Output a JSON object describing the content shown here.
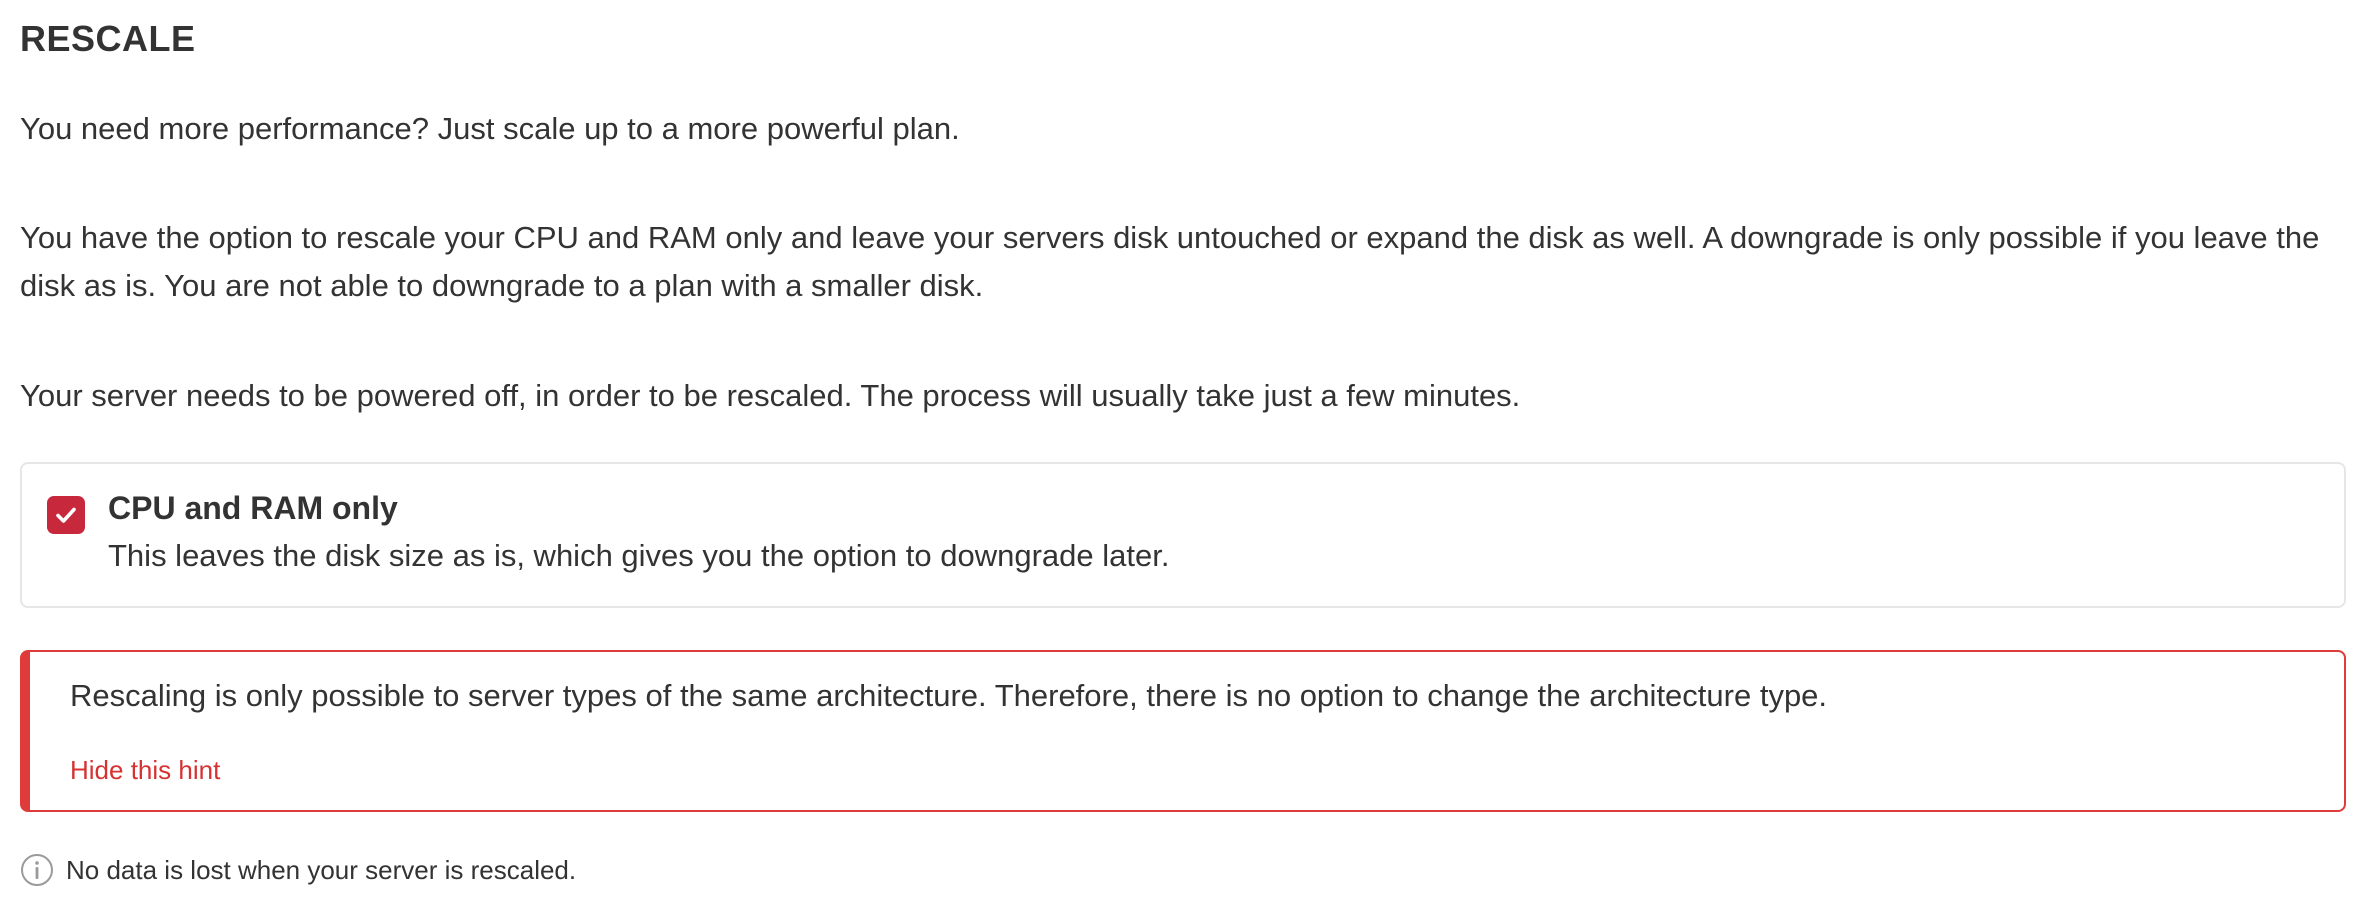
{
  "section": {
    "title": "RESCALE",
    "paragraphs": [
      "You need more performance? Just scale up to a more powerful plan.",
      "You have the option to rescale your CPU and RAM only and leave your servers disk untouched or expand the disk as well. A downgrade is only possible if you leave the disk as is. You are not able to downgrade to a plan with a smaller disk.",
      "Your server needs to be powered off, in order to be rescaled. The process will usually take just a few minutes."
    ]
  },
  "option": {
    "checked": true,
    "title": "CPU and RAM only",
    "description": "This leaves the disk size as is, which gives you the option to downgrade later.",
    "icon": "checkmark-icon",
    "accent": "#c8283c"
  },
  "hint": {
    "text": "Rescaling is only possible to server types of the same architecture. Therefore, there is no option to change the architecture type.",
    "link": "Hide this hint",
    "accent": "#e03b3b"
  },
  "info": {
    "icon": "info-icon",
    "text": "No data is lost when your server is rescaled."
  }
}
